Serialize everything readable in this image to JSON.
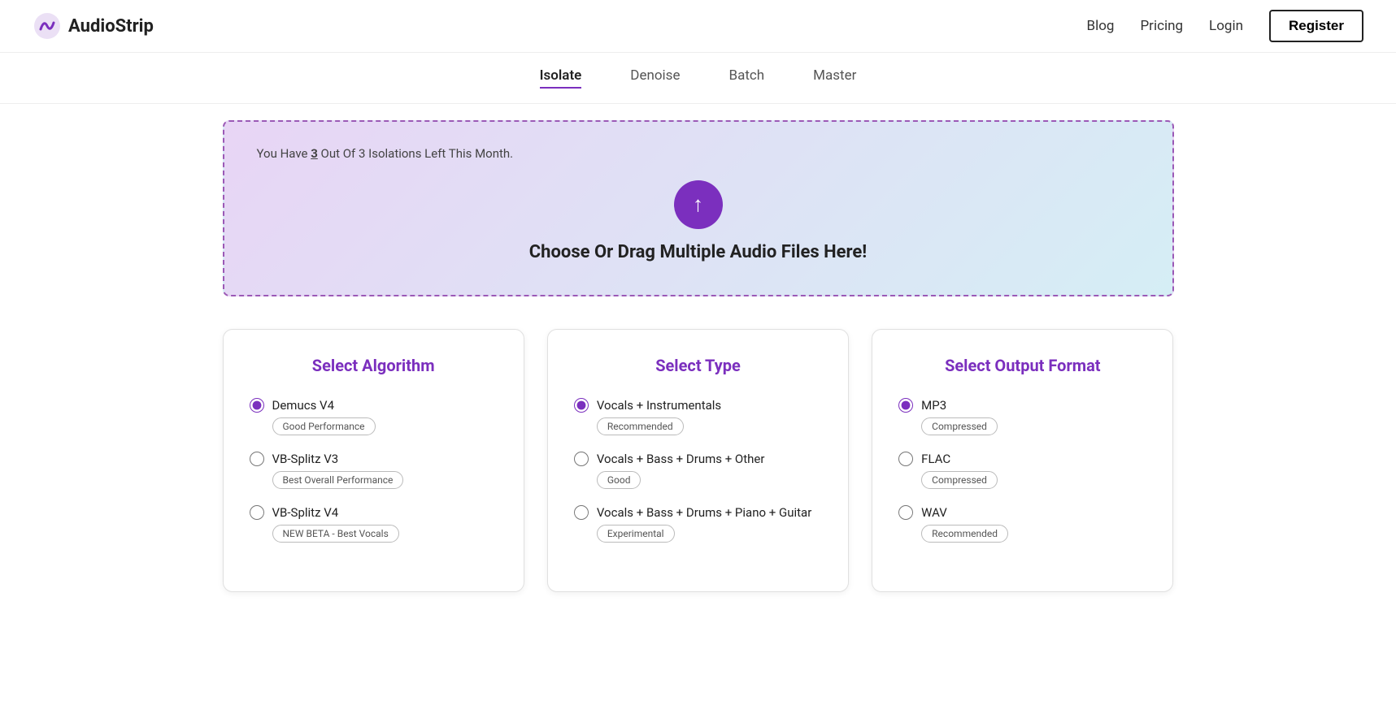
{
  "header": {
    "logo_text": "AudioStrip",
    "nav": {
      "blog": "Blog",
      "pricing": "Pricing",
      "login": "Login",
      "register": "Register"
    }
  },
  "sub_nav": {
    "items": [
      {
        "label": "Isolate",
        "active": true
      },
      {
        "label": "Denoise",
        "active": false
      },
      {
        "label": "Batch",
        "active": false
      },
      {
        "label": "Master",
        "active": false
      }
    ]
  },
  "upload": {
    "notice_prefix": "You Have ",
    "notice_count": "3",
    "notice_suffix": " Out Of 3 Isolations Left This Month.",
    "cta": "Choose Or Drag Multiple Audio Files Here!"
  },
  "cards": {
    "algorithm": {
      "title": "Select Algorithm",
      "options": [
        {
          "label": "Demucs V4",
          "badge": "Good Performance",
          "selected": true
        },
        {
          "label": "VB-Splitz V3",
          "badge": "Best Overall Performance",
          "selected": false
        },
        {
          "label": "VB-Splitz V4",
          "badge": "NEW BETA - Best Vocals",
          "selected": false
        }
      ]
    },
    "type": {
      "title": "Select Type",
      "options": [
        {
          "label": "Vocals + Instrumentals",
          "badge": "Recommended",
          "selected": true
        },
        {
          "label": "Vocals + Bass + Drums + Other",
          "badge": "Good",
          "selected": false
        },
        {
          "label": "Vocals + Bass + Drums + Piano + Guitar",
          "badge": "Experimental",
          "selected": false
        }
      ]
    },
    "output": {
      "title": "Select Output Format",
      "options": [
        {
          "label": "MP3",
          "badge": "Compressed",
          "selected": true
        },
        {
          "label": "FLAC",
          "badge": "Compressed",
          "selected": false
        },
        {
          "label": "WAV",
          "badge": "Recommended",
          "selected": false
        }
      ]
    }
  }
}
